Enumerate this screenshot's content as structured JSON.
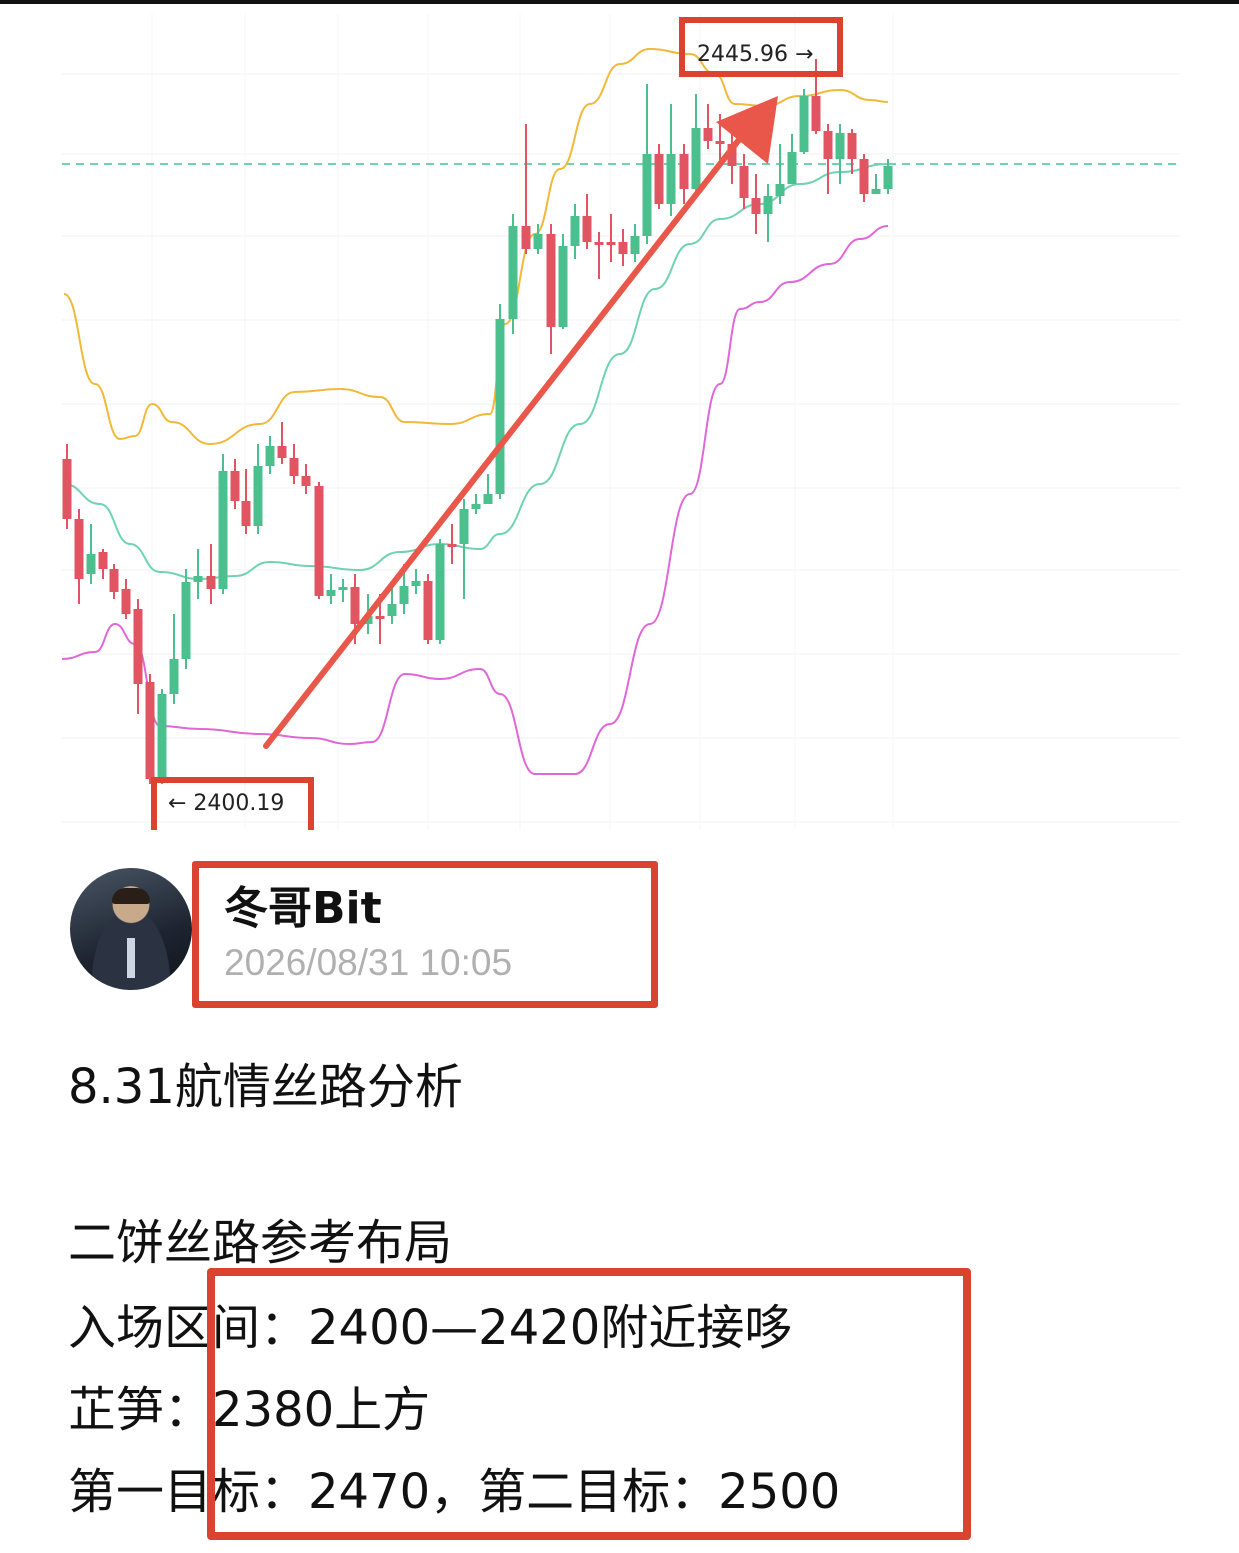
{
  "chart_data": {
    "type": "candlestick",
    "labels": {
      "high": "2445.96 →",
      "low": "← 2400.19"
    },
    "high_value": 2445.96,
    "low_value": 2400.19,
    "colors": {
      "up": "#4bbf8e",
      "down": "#e05561",
      "upper_band": "#f2b839",
      "middle_band": "#6fd3b2",
      "lower_band": "#e067d8",
      "arrow": "#e8574a",
      "highlight_box": "#d9432f"
    }
  },
  "author": {
    "avatar_icon": "user-avatar",
    "name": "冬哥Bit",
    "time": "2026/08/31 10:05"
  },
  "post": {
    "title": "8.31航情丝路分析",
    "section": "二饼丝路参考布局",
    "entry": "入场区间：2400—2420附近接哆",
    "stop": "芷笋：2380上方",
    "targets": "第一目标：2470，第二目标：2500"
  }
}
